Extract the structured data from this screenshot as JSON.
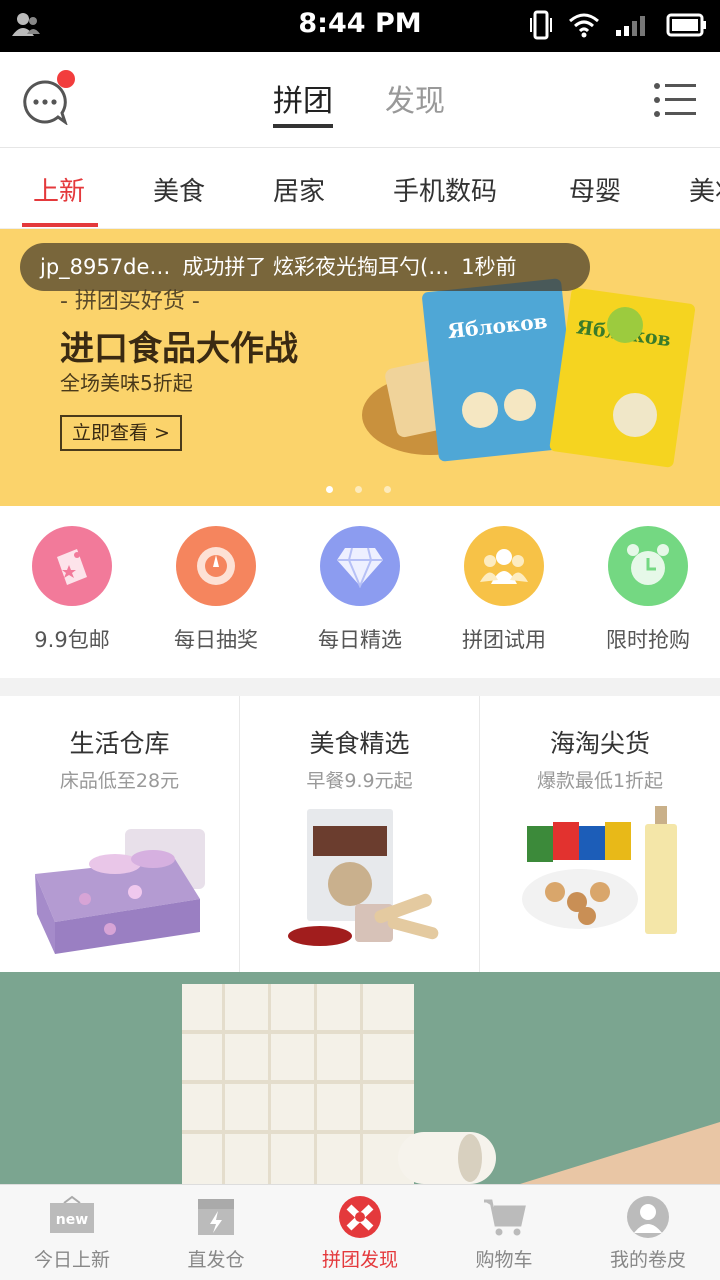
{
  "status_bar": {
    "time": "8:44 PM"
  },
  "top_tabs": [
    {
      "label": "拼团"
    },
    {
      "label": "发现"
    }
  ],
  "categories": [
    "上新",
    "美食",
    "居家",
    "手机数码",
    "母婴",
    "美妆"
  ],
  "banner": {
    "toast_user": "jp_8957de…",
    "toast_action": "成功拼了 炫彩夜光掏耳勺(…",
    "toast_time": "1秒前",
    "tagline": "- 拼团买好货 -",
    "title": "进口食品大作战",
    "subtitle": "全场美味5折起",
    "button": "立即查看 >",
    "product_text_1": "Яблоков",
    "product_text_2": "Яблоков"
  },
  "quick_actions": [
    {
      "label": "9.9包邮",
      "icon": "price-tag-icon",
      "color": "#f27a9a"
    },
    {
      "label": "每日抽奖",
      "icon": "lottery-dial-icon",
      "color": "#f5855e"
    },
    {
      "label": "每日精选",
      "icon": "diamond-icon",
      "color": "#8c9cf0"
    },
    {
      "label": "拼团试用",
      "icon": "group-icon",
      "color": "#f7c247"
    },
    {
      "label": "限时抢购",
      "icon": "alarm-clock-icon",
      "color": "#74d882"
    }
  ],
  "features": [
    {
      "title": "生活仓库",
      "subtitle": "床品低至28元"
    },
    {
      "title": "美食精选",
      "subtitle": "早餐9.9元起"
    },
    {
      "title": "海淘尖货",
      "subtitle": "爆款最低1折起"
    }
  ],
  "bottom_nav": [
    {
      "label": "今日上新",
      "icon": "new-box-icon",
      "active": false
    },
    {
      "label": "直发仓",
      "icon": "warehouse-lightning-icon",
      "active": false
    },
    {
      "label": "拼团发现",
      "icon": "pintuan-logo-icon",
      "active": true
    },
    {
      "label": "购物车",
      "icon": "shopping-cart-icon",
      "active": false
    },
    {
      "label": "我的卷皮",
      "icon": "user-avatar-icon",
      "active": false
    }
  ],
  "colors": {
    "accent": "#e4393c",
    "banner_bg": "#fbd36b",
    "promo_bg": "#7ba590"
  }
}
